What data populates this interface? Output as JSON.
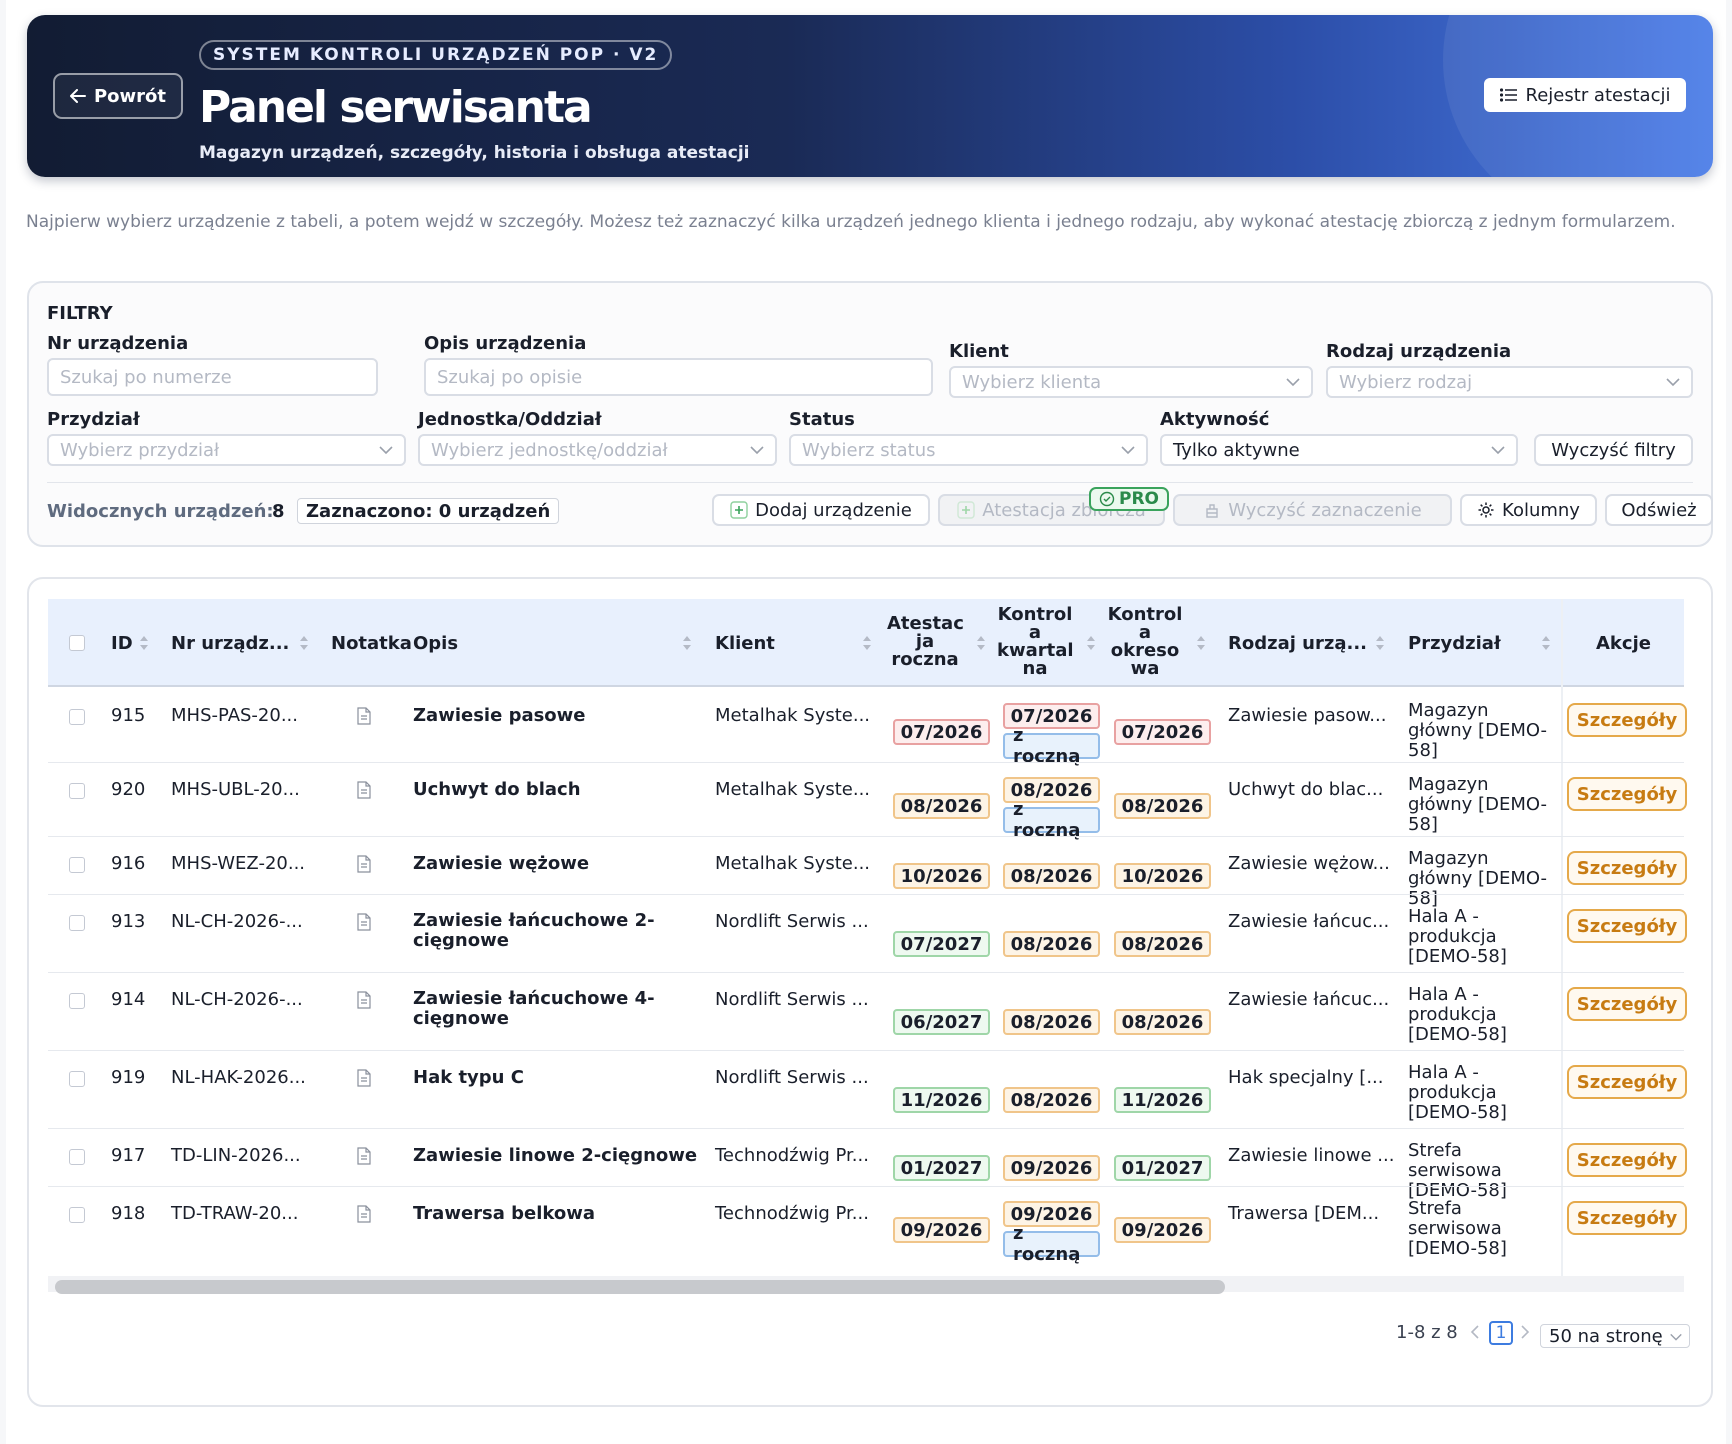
{
  "header": {
    "back_label": "Powrót",
    "system_badge": "SYSTEM KONTROLI URZĄDZEŃ POP · V2",
    "title": "Panel serwisanta",
    "subtitle": "Magazyn urządzeń, szczegóły, historia i obsługa atestacji",
    "register_label": "Rejestr atestacji"
  },
  "intro": "Najpierw wybierz urządzenie z tabeli, a potem wejdź w szczegóły. Możesz też zaznaczyć kilka urządzeń jednego klienta i jednego rodzaju, aby wykonać atestację zbiorczą z jednym formularzem.",
  "filters": {
    "title": "FILTRY",
    "nr_label": "Nr urządzenia",
    "nr_placeholder": "Szukaj po numerze",
    "opis_label": "Opis urządzenia",
    "opis_placeholder": "Szukaj po opisie",
    "klient_label": "Klient",
    "klient_placeholder": "Wybierz klienta",
    "rodzaj_label": "Rodzaj urządzenia",
    "rodzaj_placeholder": "Wybierz rodzaj",
    "przydzial_label": "Przydział",
    "przydzial_placeholder": "Wybierz przydział",
    "jednostka_label": "Jednostka/Oddział",
    "jednostka_placeholder": "Wybierz jednostkę/oddział",
    "status_label": "Status",
    "status_placeholder": "Wybierz status",
    "aktywnosc_label": "Aktywność",
    "aktywnosc_value": "Tylko aktywne",
    "clear_filters_label": "Wyczyść filtry",
    "visible_label": "Widocznych urządzeń:",
    "visible_count": "8",
    "selected_label": "Zaznaczono: 0 urządzeń",
    "add_device_label": "Dodaj urządzenie",
    "bulk_label": "Atestacja zbiorcza",
    "pro_label": "PRO",
    "clear_selection_label": "Wyczyść zaznaczenie",
    "columns_label": "Kolumny",
    "refresh_label": "Odśwież"
  },
  "table": {
    "headers": {
      "id": "ID",
      "nr": "Nr urządz...",
      "note": "Notatka",
      "opis": "Opis",
      "klient": "Klient",
      "atestacja": "Atestac ja roczna",
      "kwartalna": "Kontrol a kwartal na",
      "okresowa": "Kontrol a okreso wa",
      "rodzaj": "Rodzaj urzą...",
      "przydzial": "Przydział",
      "akcje": "Akcje"
    },
    "details_label": "Szczegóły",
    "with_annual_label": "z roczną",
    "rows": [
      {
        "id": "915",
        "nr": "MHS-PAS-20...",
        "opis": "Zawiesie pasowe",
        "klient": "Metalhak Syste...",
        "atestacja": "07/2026",
        "kwartalna": "07/2026",
        "okresowa": "07/2026",
        "rodzaj": "Zawiesie pasow...",
        "przydzial": "Magazyn główny [DEMO-58]"
      },
      {
        "id": "920",
        "nr": "MHS-UBL-20...",
        "opis": "Uchwyt do blach",
        "klient": "Metalhak Syste...",
        "atestacja": "08/2026",
        "kwartalna": "08/2026",
        "okresowa": "08/2026",
        "rodzaj": "Uchwyt do blac...",
        "przydzial": "Magazyn główny [DEMO-58]"
      },
      {
        "id": "916",
        "nr": "MHS-WEZ-20...",
        "opis": "Zawiesie wężowe",
        "klient": "Metalhak Syste...",
        "atestacja": "10/2026",
        "kwartalna": "08/2026",
        "okresowa": "10/2026",
        "rodzaj": "Zawiesie wężow...",
        "przydzial": "Magazyn główny [DEMO-58]"
      },
      {
        "id": "913",
        "nr": "NL-CH-2026-...",
        "opis": "Zawiesie łańcuchowe 2-cięgnowe",
        "klient": "Nordlift Serwis ...",
        "atestacja": "07/2027",
        "kwartalna": "08/2026",
        "okresowa": "08/2026",
        "rodzaj": "Zawiesie łańcuc...",
        "przydzial": "Hala A - produkcja [DEMO-58]"
      },
      {
        "id": "914",
        "nr": "NL-CH-2026-...",
        "opis": "Zawiesie łańcuchowe 4-cięgnowe",
        "klient": "Nordlift Serwis ...",
        "atestacja": "06/2027",
        "kwartalna": "08/2026",
        "okresowa": "08/2026",
        "rodzaj": "Zawiesie łańcuc...",
        "przydzial": "Hala A - produkcja [DEMO-58]"
      },
      {
        "id": "919",
        "nr": "NL-HAK-2026...",
        "opis": "Hak typu C",
        "klient": "Nordlift Serwis ...",
        "atestacja": "11/2026",
        "kwartalna": "08/2026",
        "okresowa": "11/2026",
        "rodzaj": "Hak specjalny [...",
        "przydzial": "Hala A - produkcja [DEMO-58]"
      },
      {
        "id": "917",
        "nr": "TD-LIN-2026...",
        "opis": "Zawiesie linowe 2-cięgnowe",
        "klient": "Technodźwig Pr...",
        "atestacja": "01/2027",
        "kwartalna": "09/2026",
        "okresowa": "01/2027",
        "rodzaj": "Zawiesie linowe ...",
        "przydzial": "Strefa serwisowa [DEMO-58]"
      },
      {
        "id": "918",
        "nr": "TD-TRAW-20...",
        "opis": "Trawersa belkowa",
        "klient": "Technodźwig Pr...",
        "atestacja": "09/2026",
        "kwartalna": "09/2026",
        "okresowa": "09/2026",
        "rodzaj": "Trawersa [DEM...",
        "przydzial": "Strefa serwisowa [DEMO-58]"
      }
    ]
  },
  "pagination": {
    "range": "1-8 z 8",
    "current_page": "1",
    "per_page": "50 na stronę"
  },
  "colors": {
    "hero_dark": "#121c33",
    "hero_light": "#4a7ce8",
    "details_orange": "#c77b12",
    "pill_red": "#e8a1a1",
    "pill_orange": "#f0c58a",
    "pill_green": "#9fd6a8",
    "pill_blue": "#94bde9",
    "pro_green": "#3aa35c"
  }
}
